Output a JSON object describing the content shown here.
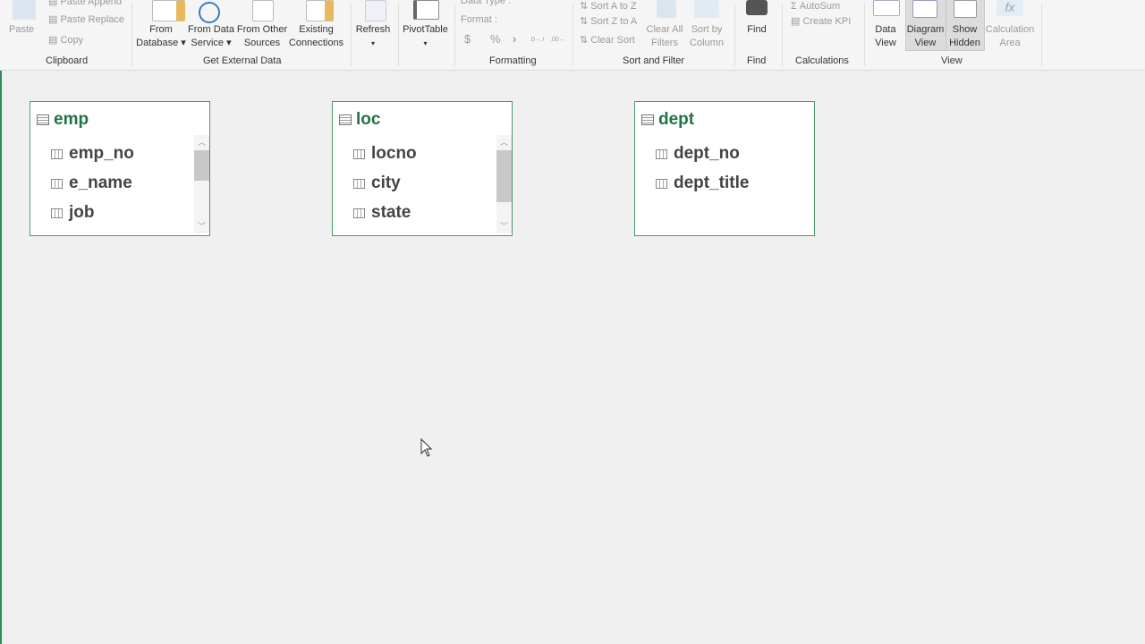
{
  "ribbon": {
    "clipboard": {
      "paste": "Paste",
      "paste_append": "Paste Append",
      "paste_replace": "Paste Replace",
      "copy": "Copy",
      "label": "Clipboard"
    },
    "external": {
      "from_database": [
        "From",
        "Database ▾"
      ],
      "from_data_service": [
        "From Data",
        "Service ▾"
      ],
      "from_other": [
        "From Other",
        "Sources"
      ],
      "existing": [
        "Existing",
        "Connections"
      ],
      "label": "Get External Data"
    },
    "refresh": {
      "label": "Refresh",
      "arrow": "▾"
    },
    "pivot": {
      "label": "PivotTable",
      "arrow": "▾"
    },
    "formatting": {
      "data_type": "Data Type :",
      "format": "Format :",
      "symbols": [
        "$",
        "%",
        "›",
        ".0→.00",
        ".00→.0"
      ],
      "label": "Formatting"
    },
    "sort": {
      "a_to_z": "Sort A to Z",
      "z_to_a": "Sort Z to A",
      "clear_sort": "Clear Sort",
      "clear_filters": [
        "Clear All",
        "Filters"
      ],
      "sort_by_column": [
        "Sort by",
        "Column"
      ],
      "label": "Sort and Filter"
    },
    "find": {
      "button": "Find",
      "label": "Find"
    },
    "calc": {
      "autosum": "AutoSum",
      "create_kpi": "Create KPI",
      "label": "Calculations"
    },
    "view": {
      "data_view": [
        "Data",
        "View"
      ],
      "diagram_view": [
        "Diagram",
        "View"
      ],
      "show_hidden": [
        "Show",
        "Hidden"
      ],
      "calc_area": [
        "Calculation",
        "Area"
      ],
      "label": "View"
    }
  },
  "tables": [
    {
      "name": "emp",
      "columns": [
        "emp_no",
        "e_name",
        "job"
      ]
    },
    {
      "name": "loc",
      "columns": [
        "locno",
        "city",
        "state"
      ]
    },
    {
      "name": "dept",
      "columns": [
        "dept_no",
        "dept_title"
      ]
    }
  ]
}
